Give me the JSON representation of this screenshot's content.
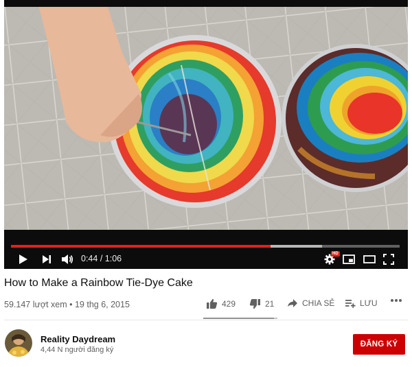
{
  "player": {
    "current_time": "0:44",
    "duration": "1:06",
    "progress_fraction": 0.667,
    "buffered_fraction": 0.8,
    "settings_badge": "HD",
    "icons": {
      "play": "play-icon",
      "next": "next-icon",
      "volume": "volume-icon",
      "settings": "gear-icon",
      "miniplayer": "miniplayer-icon",
      "theater": "theater-icon",
      "fullscreen": "fullscreen-icon"
    }
  },
  "video": {
    "title": "How to Make a Rainbow Tie-Dye Cake",
    "views": "59.147 lượt xem",
    "separator": "•",
    "date": "19 thg 6, 2015"
  },
  "actions": {
    "likes": "429",
    "dislikes": "21",
    "share_label": "CHIA SẺ",
    "save_label": "LƯU",
    "more_icon": "more-icon",
    "like_fraction": 0.953
  },
  "channel": {
    "name": "Reality Daydream",
    "subscribers": "4,44 N người đăng ký",
    "subscribe_label": "ĐĂNG KÝ"
  },
  "colors": {
    "accent_red": "#e62117",
    "subscribe_red": "#cc0000",
    "text_primary": "#0d0d0d",
    "text_secondary": "#606060"
  }
}
